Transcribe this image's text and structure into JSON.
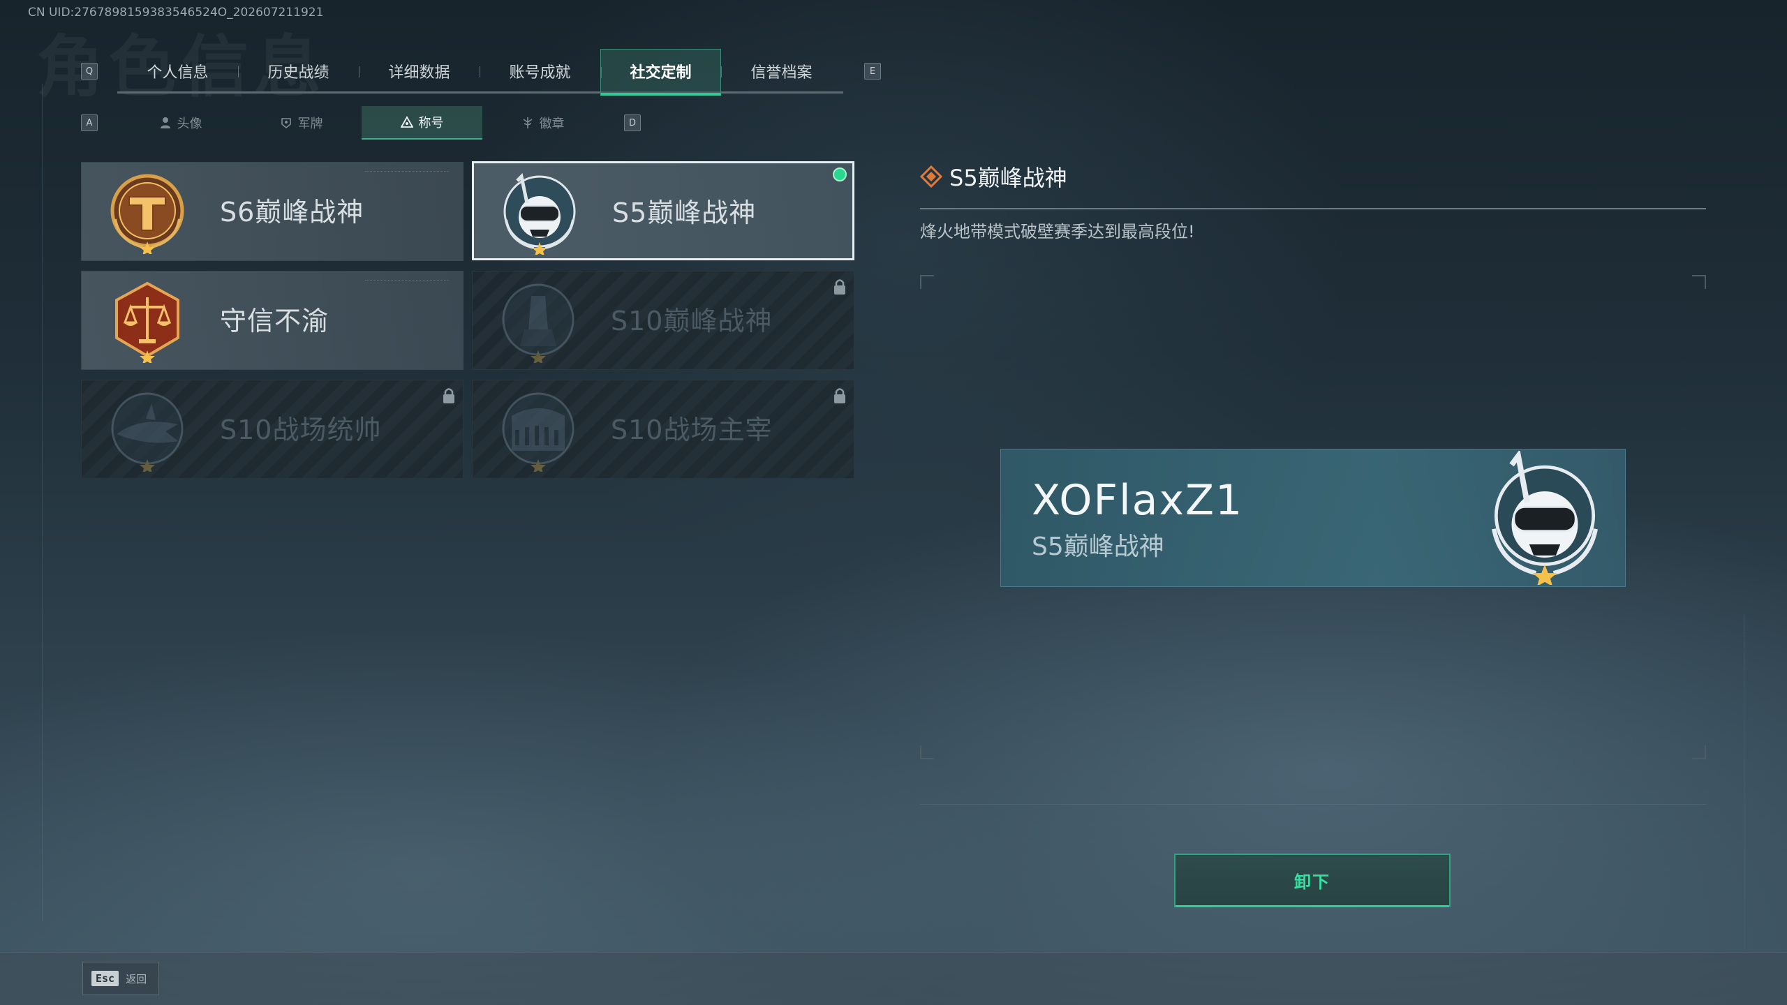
{
  "header": {
    "uid": "CN UID:2767898159383546524О_202607211921",
    "bg_title": "角色信息"
  },
  "tabs": {
    "prev_key": "Q",
    "next_key": "E",
    "items": [
      {
        "label": "个人信息"
      },
      {
        "label": "历史战绩"
      },
      {
        "label": "详细数据"
      },
      {
        "label": "账号成就"
      },
      {
        "label": "社交定制",
        "active": true
      },
      {
        "label": "信誉档案"
      }
    ]
  },
  "subtabs": {
    "prev_key": "A",
    "next_key": "D",
    "items": [
      {
        "label": "头像",
        "icon": "person-icon"
      },
      {
        "label": "军牌",
        "icon": "dogtag-icon"
      },
      {
        "label": "称号",
        "icon": "title-icon",
        "active": true
      },
      {
        "label": "徽章",
        "icon": "badge-icon"
      }
    ]
  },
  "titles": [
    {
      "label": "S6巅峰战神",
      "state": "owned",
      "emblem": "gold-t-emblem"
    },
    {
      "label": "S5巅峰战神",
      "state": "selected",
      "emblem": "diver-skull-emblem",
      "equipped": true
    },
    {
      "label": "守信不渝",
      "state": "owned",
      "emblem": "scales-emblem"
    },
    {
      "label": "S10巅峰战神",
      "state": "locked",
      "emblem": "tower-emblem"
    },
    {
      "label": "S10战场统帅",
      "state": "locked",
      "emblem": "shark-emblem"
    },
    {
      "label": "S10战场主宰",
      "state": "locked",
      "emblem": "colosseum-emblem"
    }
  ],
  "detail": {
    "title": "S5巅峰战神",
    "description": "烽火地带模式破壁赛季达到最高段位!"
  },
  "nameplate": {
    "player_name": "XOFlaxZ1",
    "title": "S5巅峰战神"
  },
  "actions": {
    "unequip_label": "卸下",
    "esc_key": "Esc",
    "back_label": "返回"
  },
  "colors": {
    "accent": "#34c796",
    "equipped_dot": "#27d88e",
    "title_diamond": "#e07a3a"
  }
}
